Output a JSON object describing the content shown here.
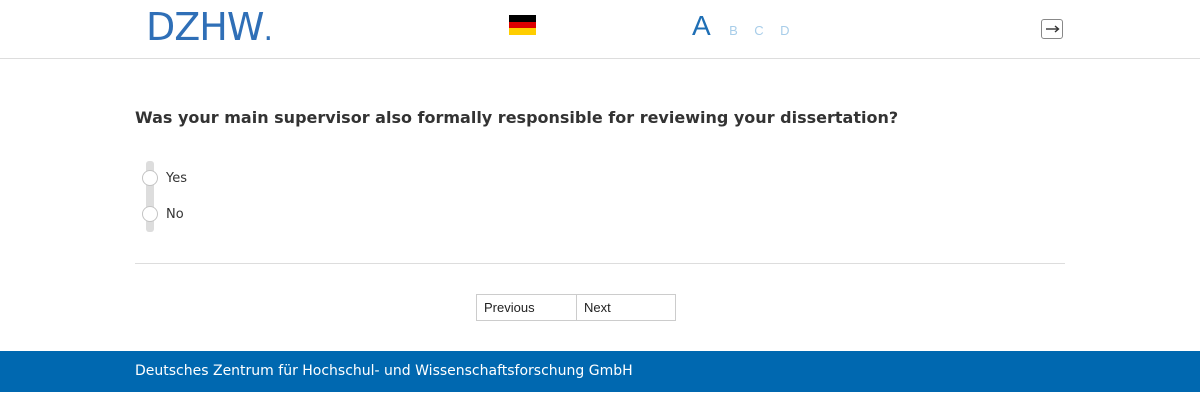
{
  "header": {
    "logo_text": "DZHW",
    "logo_dot": ".",
    "language_flag": "german-flag-icon",
    "language_options": [
      "A",
      "B",
      "C",
      "D"
    ],
    "active_option": "A",
    "exit_icon": "exit-icon"
  },
  "question": {
    "text": "Was your main supervisor also formally responsible for reviewing your dissertation?",
    "options": [
      {
        "label": "Yes"
      },
      {
        "label": "No"
      }
    ]
  },
  "navigation": {
    "previous_label": "Previous",
    "next_label": "Next"
  },
  "footer": {
    "text": "Deutsches Zentrum für Hochschul- und Wissenschaftsforschung GmbH"
  },
  "colors": {
    "brand_blue": "#0068b0",
    "logo_blue": "#2f6fb7",
    "inactive_letter": "#a8cde9"
  }
}
